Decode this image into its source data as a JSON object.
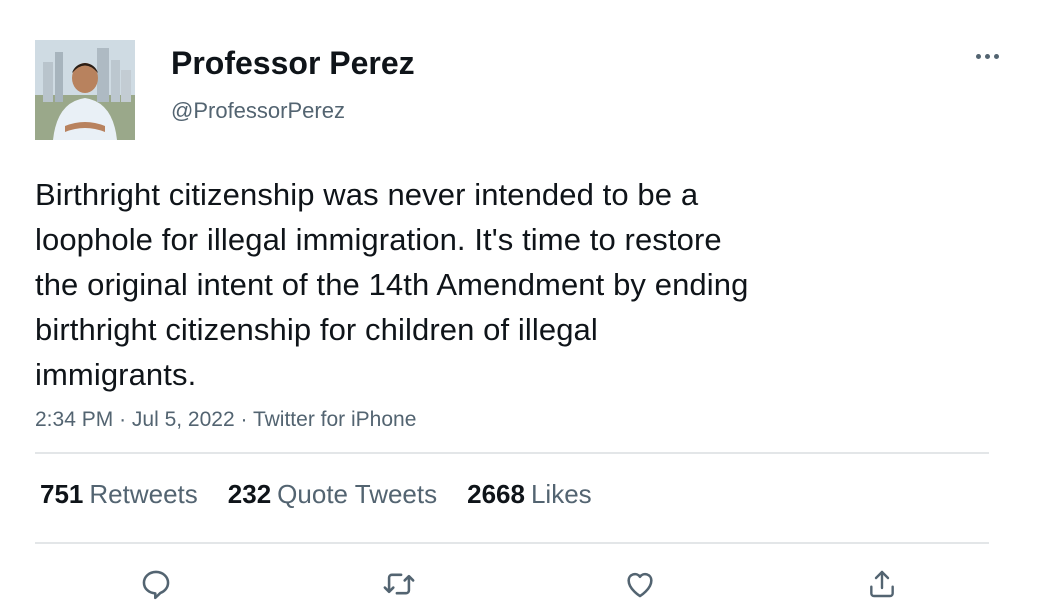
{
  "author": {
    "name": "Professor Perez",
    "handle": "@ProfessorPerez",
    "avatar_icon": "profile-photo"
  },
  "tweet": {
    "lines": [
      "Birthright citizenship was never intended to be a",
      "loophole for illegal immigration. It's time to restore",
      "the original intent of the 14th Amendment by ending",
      "birthright citizenship for children of illegal",
      "immigrants."
    ],
    "time": "2:34 PM",
    "date": "Jul 5, 2022",
    "source": "Twitter for iPhone",
    "separator": "·"
  },
  "stats": {
    "retweets_count": "751",
    "retweets_label": "Retweets",
    "quotes_count": "232",
    "quotes_label": "Quote Tweets",
    "likes_count": "2668",
    "likes_label": "Likes"
  },
  "actions": [
    {
      "icon": "reply-icon"
    },
    {
      "icon": "retweet-icon"
    },
    {
      "icon": "like-icon"
    },
    {
      "icon": "share-icon"
    }
  ],
  "colors": {
    "text": "#0f1419",
    "secondary": "#536471",
    "divider": "#e3e6e8"
  }
}
